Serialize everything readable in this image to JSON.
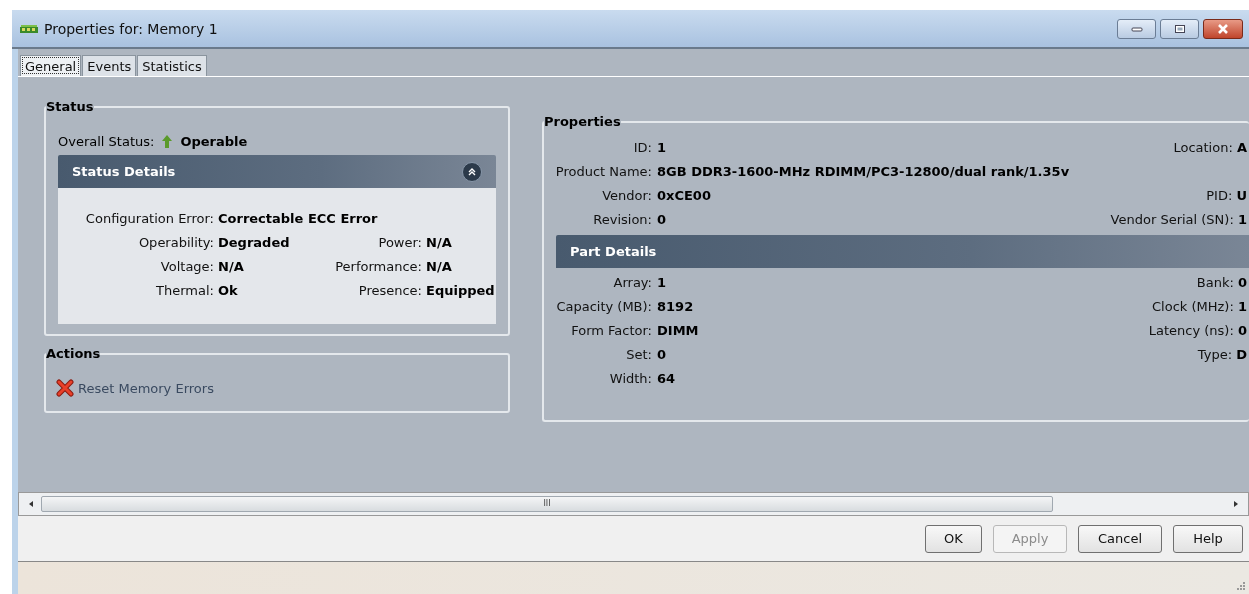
{
  "window": {
    "title": "Properties for: Memory 1"
  },
  "tabs": [
    {
      "label": "General",
      "selected": true
    },
    {
      "label": "Events",
      "selected": false
    },
    {
      "label": "Statistics",
      "selected": false
    }
  ],
  "status": {
    "legend": "Status",
    "overall_label": "Overall Status:",
    "overall_value": "Operable",
    "details": {
      "title": "Status Details",
      "expanded": true,
      "rows": [
        [
          {
            "label": "Configuration Error:",
            "value": "Correctable ECC Error"
          }
        ],
        [
          {
            "label": "Operability:",
            "value": "Degraded"
          },
          {
            "label": "Power:",
            "value": "N/A"
          }
        ],
        [
          {
            "label": "Voltage:",
            "value": "N/A"
          },
          {
            "label": "Performance:",
            "value": "N/A"
          }
        ],
        [
          {
            "label": "Thermal:",
            "value": "Ok"
          },
          {
            "label": "Presence:",
            "value": "Equipped"
          }
        ]
      ]
    }
  },
  "actions": {
    "legend": "Actions",
    "items": [
      {
        "label": "Reset Memory Errors"
      }
    ]
  },
  "properties": {
    "legend": "Properties",
    "rows": [
      {
        "label": "ID:",
        "value": "1",
        "right_label": "Location:",
        "right_value": "A"
      },
      {
        "label": "Product Name:",
        "value": "8GB DDR3-1600-MHz RDIMM/PC3-12800/dual rank/1.35v"
      },
      {
        "label": "Vendor:",
        "value": "0xCE00",
        "right_label": "PID:",
        "right_value": "U"
      },
      {
        "label": "Revision:",
        "value": "0",
        "right_label": "Vendor Serial (SN):",
        "right_value": "1"
      }
    ],
    "part_details": {
      "title": "Part Details",
      "rows": [
        {
          "label": "Array:",
          "value": "1",
          "right_label": "Bank:",
          "right_value": "0"
        },
        {
          "label": "Capacity (MB):",
          "value": "8192",
          "right_label": "Clock (MHz):",
          "right_value": "1"
        },
        {
          "label": "Form Factor:",
          "value": "DIMM",
          "right_label": "Latency (ns):",
          "right_value": "0"
        },
        {
          "label": "Set:",
          "value": "0",
          "right_label": "Type:",
          "right_value": "D"
        },
        {
          "label": "Width:",
          "value": "64"
        }
      ]
    }
  },
  "scrollbar_grip": "III",
  "buttons": [
    {
      "label": "OK",
      "disabled": false
    },
    {
      "label": "Apply",
      "disabled": true
    },
    {
      "label": "Cancel",
      "disabled": false
    },
    {
      "label": "Help",
      "disabled": false
    }
  ]
}
